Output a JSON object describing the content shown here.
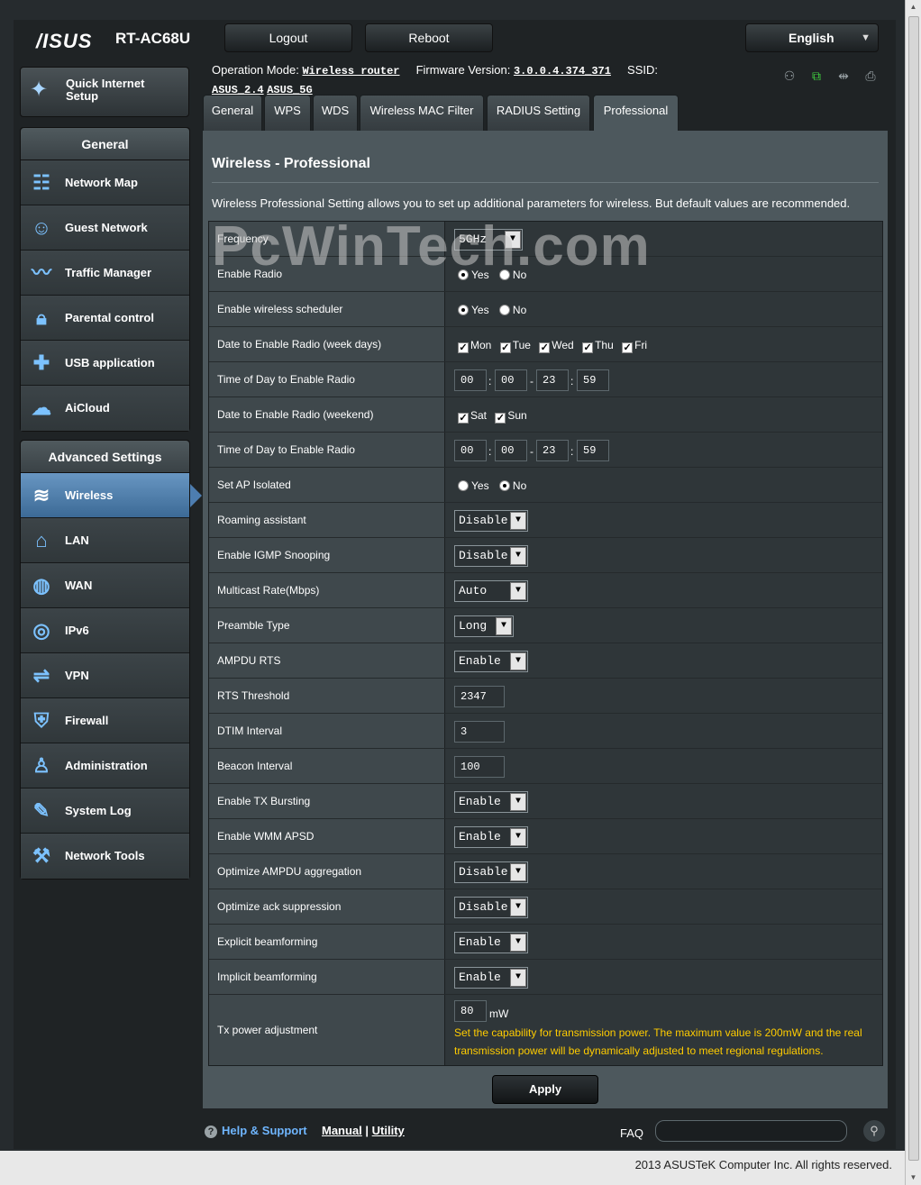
{
  "header": {
    "logo": "/ISUS",
    "model": "RT-AC68U",
    "logout": "Logout",
    "reboot": "Reboot",
    "language": "English"
  },
  "status": {
    "op_mode_label": "Operation Mode:",
    "op_mode_value": "Wireless router",
    "fw_label": "Firmware Version:",
    "fw_value": "3.0.0.4.374_371",
    "ssid_label": "SSID:",
    "ssid_1": "ASUS_2.4",
    "ssid_2": "ASUS_5G"
  },
  "sidebar": {
    "qis": "Quick Internet Setup",
    "general_head": "General",
    "general_items": [
      {
        "label": "Network Map",
        "icon": "network-map-icon"
      },
      {
        "label": "Guest Network",
        "icon": "guest-network-icon"
      },
      {
        "label": "Traffic Manager",
        "icon": "traffic-manager-icon"
      },
      {
        "label": "Parental control",
        "icon": "lock-icon"
      },
      {
        "label": "USB application",
        "icon": "puzzle-icon"
      },
      {
        "label": "AiCloud",
        "icon": "cloud-icon"
      }
    ],
    "advanced_head": "Advanced Settings",
    "advanced_items": [
      {
        "label": "Wireless",
        "icon": "wifi-icon",
        "active": true
      },
      {
        "label": "LAN",
        "icon": "home-icon"
      },
      {
        "label": "WAN",
        "icon": "globe-icon"
      },
      {
        "label": "IPv6",
        "icon": "ipv6-icon"
      },
      {
        "label": "VPN",
        "icon": "vpn-icon"
      },
      {
        "label": "Firewall",
        "icon": "shield-icon"
      },
      {
        "label": "Administration",
        "icon": "admin-icon"
      },
      {
        "label": "System Log",
        "icon": "log-icon"
      },
      {
        "label": "Network Tools",
        "icon": "tools-icon"
      }
    ]
  },
  "tabs": [
    "General",
    "WPS",
    "WDS",
    "Wireless MAC Filter",
    "RADIUS Setting",
    "Professional"
  ],
  "content": {
    "title": "Wireless - Professional",
    "description": "Wireless Professional Setting allows you to set up additional parameters for wireless. But default values are recommended.",
    "watermark": "PcWinTech.com",
    "rows": {
      "frequency": {
        "label": "Frequency",
        "value": "5GHz"
      },
      "enable_radio": {
        "label": "Enable Radio",
        "yes": "Yes",
        "no": "No"
      },
      "scheduler": {
        "label": "Enable wireless scheduler",
        "yes": "Yes",
        "no": "No"
      },
      "weekdays": {
        "label": "Date to Enable Radio (week days)",
        "days": [
          "Mon",
          "Tue",
          "Wed",
          "Thu",
          "Fri"
        ]
      },
      "time_weekdays": {
        "label": "Time of Day to Enable Radio",
        "h1": "00",
        "m1": "00",
        "h2": "23",
        "m2": "59"
      },
      "weekend": {
        "label": "Date to Enable Radio (weekend)",
        "days": [
          "Sat",
          "Sun"
        ]
      },
      "time_weekend": {
        "label": "Time of Day to Enable Radio",
        "h1": "00",
        "m1": "00",
        "h2": "23",
        "m2": "59"
      },
      "ap_isolated": {
        "label": "Set AP Isolated",
        "yes": "Yes",
        "no": "No"
      },
      "roaming": {
        "label": "Roaming assistant",
        "value": "Disable"
      },
      "igmp": {
        "label": "Enable IGMP Snooping",
        "value": "Disable"
      },
      "multicast": {
        "label": "Multicast Rate(Mbps)",
        "value": "Auto"
      },
      "preamble": {
        "label": "Preamble Type",
        "value": "Long"
      },
      "ampdu_rts": {
        "label": "AMPDU RTS",
        "value": "Enable"
      },
      "rts": {
        "label": "RTS Threshold",
        "value": "2347"
      },
      "dtim": {
        "label": "DTIM Interval",
        "value": "3"
      },
      "beacon": {
        "label": "Beacon Interval",
        "value": "100"
      },
      "tx_burst": {
        "label": "Enable TX Bursting",
        "value": "Enable"
      },
      "wmm_apsd": {
        "label": "Enable WMM APSD",
        "value": "Enable"
      },
      "ampdu_agg": {
        "label": "Optimize AMPDU aggregation",
        "value": "Disable"
      },
      "ack_supp": {
        "label": "Optimize ack suppression",
        "value": "Disable"
      },
      "explicit_bf": {
        "label": "Explicit beamforming",
        "value": "Enable"
      },
      "implicit_bf": {
        "label": "Implicit beamforming",
        "value": "Enable"
      },
      "tx_power": {
        "label": "Tx power adjustment",
        "value": "80",
        "unit": "mW",
        "note": "Set the capability for transmission power. The maximum value is 200mW and the real transmission power will be dynamically adjusted to meet regional regulations."
      }
    },
    "apply": "Apply"
  },
  "bottom": {
    "help": "Help & Support",
    "manual": "Manual",
    "utility": "Utility",
    "faq": "FAQ",
    "copyright": "2013 ASUSTeK Computer Inc. All rights reserved."
  }
}
